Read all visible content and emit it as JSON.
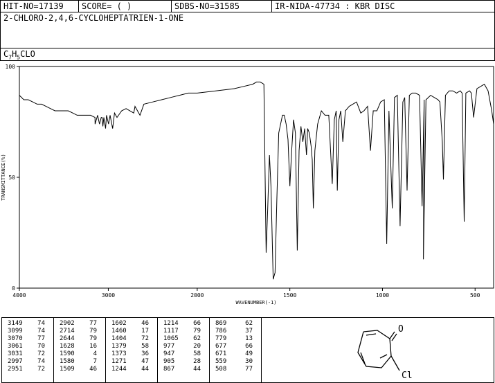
{
  "header": {
    "hit_no": "HIT-NO=17139",
    "score": "SCORE=  (  )",
    "sdbs_no": "SDBS-NO=31585",
    "ir_info": "IR-NIDA-47734 : KBR DISC",
    "compound": "2-CHLORO-2,4,6-CYCLOHEPTATRIEN-1-ONE",
    "formula_parts": [
      "C",
      "7",
      "H",
      "5",
      "CLO"
    ]
  },
  "chart_data": {
    "type": "line",
    "xlabel": "WAVENUMBER(-1)",
    "ylabel": "TRANSMITTANCE(%)",
    "xlim": [
      4000,
      400
    ],
    "ylim": [
      0,
      100
    ],
    "x_ticks": [
      "4000",
      "3000",
      "2000",
      "1500",
      "1000",
      "500"
    ],
    "y_ticks": [
      "100",
      "50",
      "0"
    ],
    "grid": false,
    "series": [
      {
        "x": [
          4000,
          3950,
          3900,
          3850,
          3800,
          3750,
          3700,
          3650,
          3600,
          3550,
          3500,
          3450,
          3400,
          3350,
          3300,
          3250,
          3200,
          3150,
          3149,
          3120,
          3099,
          3080,
          3070,
          3061,
          3050,
          3031,
          3020,
          2997,
          2980,
          2951,
          2930,
          2902,
          2850,
          2800,
          2714,
          2700,
          2644,
          2600,
          2500,
          2400,
          2300,
          2200,
          2100,
          2000,
          1900,
          1800,
          1750,
          1700,
          1680,
          1660,
          1640,
          1628,
          1620,
          1610,
          1602,
          1590,
          1580,
          1570,
          1560,
          1540,
          1530,
          1520,
          1510,
          1500,
          1490,
          1480,
          1470,
          1460,
          1450,
          1440,
          1430,
          1420,
          1410,
          1404,
          1395,
          1385,
          1379,
          1373,
          1365,
          1350,
          1330,
          1310,
          1290,
          1271,
          1260,
          1250,
          1244,
          1235,
          1225,
          1214,
          1200,
          1180,
          1160,
          1140,
          1117,
          1100,
          1080,
          1065,
          1050,
          1030,
          1010,
          990,
          977,
          965,
          947,
          935,
          920,
          905,
          890,
          880,
          867,
          855,
          840,
          820,
          800,
          786,
          775,
          779,
          765,
          740,
          720,
          700,
          690,
          677,
          671,
          660,
          640,
          620,
          600,
          580,
          570,
          559,
          550,
          530,
          520,
          508,
          490,
          470,
          450,
          430,
          410,
          400
        ],
        "y": [
          87,
          85,
          85,
          84,
          83,
          83,
          82,
          81,
          80,
          80,
          80,
          80,
          79,
          78,
          78,
          78,
          78,
          77,
          74,
          78,
          74,
          77,
          77,
          73,
          77,
          72,
          78,
          74,
          78,
          72,
          79,
          77,
          80,
          81,
          79,
          82,
          78,
          83,
          84,
          85,
          86,
          87,
          88,
          88,
          89,
          90,
          91,
          92,
          93,
          93,
          92,
          16,
          35,
          60,
          46,
          4,
          7,
          40,
          70,
          78,
          78,
          74,
          67,
          46,
          62,
          76,
          70,
          17,
          62,
          73,
          66,
          72,
          60,
          72,
          70,
          64,
          58,
          36,
          62,
          74,
          80,
          78,
          78,
          47,
          76,
          80,
          44,
          76,
          80,
          66,
          80,
          82,
          83,
          84,
          79,
          80,
          82,
          62,
          80,
          80,
          84,
          85,
          20,
          80,
          36,
          86,
          87,
          28,
          84,
          86,
          44,
          87,
          88,
          88,
          87,
          37,
          85,
          13,
          85,
          87,
          86,
          85,
          84,
          66,
          49,
          87,
          89,
          89,
          88,
          89,
          88,
          30,
          88,
          89,
          88,
          77,
          90,
          91,
          92,
          89,
          80,
          74
        ]
      }
    ]
  },
  "peak_table": {
    "columns": [
      [
        [
          "3149",
          "74"
        ],
        [
          "3099",
          "74"
        ],
        [
          "3070",
          "77"
        ],
        [
          "3061",
          "70"
        ],
        [
          "3031",
          "72"
        ],
        [
          "2997",
          "74"
        ],
        [
          "2951",
          "72"
        ]
      ],
      [
        [
          "2902",
          "77"
        ],
        [
          "2714",
          "79"
        ],
        [
          "2644",
          "79"
        ],
        [
          "1628",
          "16"
        ],
        [
          "1590",
          "4"
        ],
        [
          "1580",
          "7"
        ],
        [
          "1509",
          "46"
        ]
      ],
      [
        [
          "1602",
          "46"
        ],
        [
          "1460",
          "17"
        ],
        [
          "1404",
          "72"
        ],
        [
          "1379",
          "58"
        ],
        [
          "1373",
          "36"
        ],
        [
          "1271",
          "47"
        ],
        [
          "1244",
          "44"
        ]
      ],
      [
        [
          "1214",
          "66"
        ],
        [
          "1117",
          "79"
        ],
        [
          "1065",
          "62"
        ],
        [
          "977",
          "20"
        ],
        [
          "947",
          "58"
        ],
        [
          "905",
          "28"
        ],
        [
          "867",
          "44"
        ]
      ],
      [
        [
          "869",
          "62"
        ],
        [
          "786",
          "37"
        ],
        [
          "779",
          "13"
        ],
        [
          "677",
          "66"
        ],
        [
          "671",
          "49"
        ],
        [
          "559",
          "30"
        ],
        [
          "508",
          "77"
        ]
      ]
    ]
  },
  "structure": {
    "atom_o": "O",
    "atom_cl": "Cl"
  }
}
